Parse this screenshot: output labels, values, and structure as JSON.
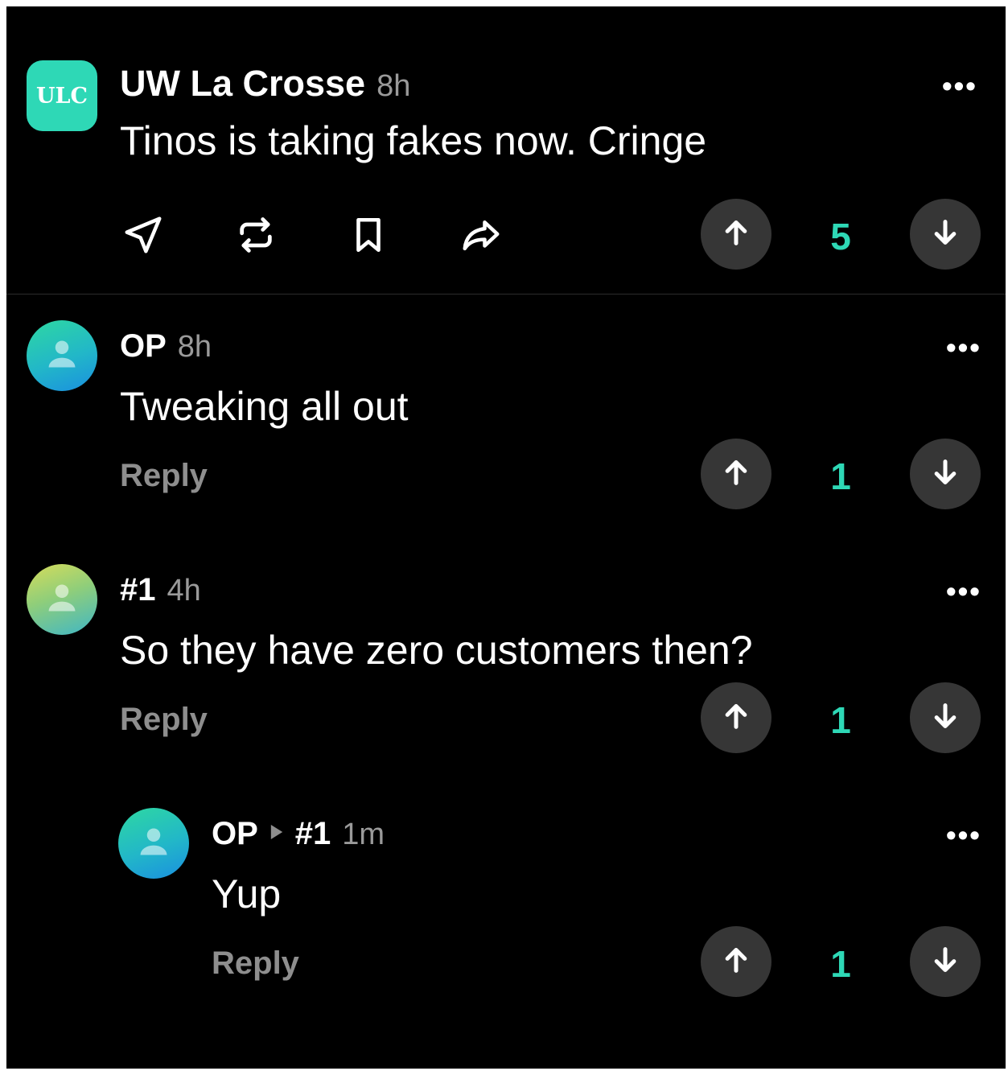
{
  "post": {
    "avatar_text": "ULC",
    "author": "UW La Crosse",
    "time": "8h",
    "text": "Tinos is taking fakes now. Cringe",
    "more": "•••",
    "score": "5",
    "actions": [
      "send-icon",
      "repost-icon",
      "bookmark-icon",
      "share-icon"
    ]
  },
  "comments": [
    {
      "author": "OP",
      "time": "8h",
      "text": "Tweaking all out",
      "reply_label": "Reply",
      "score": "1",
      "more": "•••"
    },
    {
      "author": "#1",
      "time": "4h",
      "text": "So they have zero customers then?",
      "reply_label": "Reply",
      "score": "1",
      "more": "•••"
    },
    {
      "author": "OP",
      "reply_to": "#1",
      "time": "1m",
      "text": "Yup",
      "reply_label": "Reply",
      "score": "1",
      "more": "•••"
    }
  ],
  "colors": {
    "accent": "#2ed8b6",
    "background": "#000000",
    "vote_bg": "#363636"
  }
}
